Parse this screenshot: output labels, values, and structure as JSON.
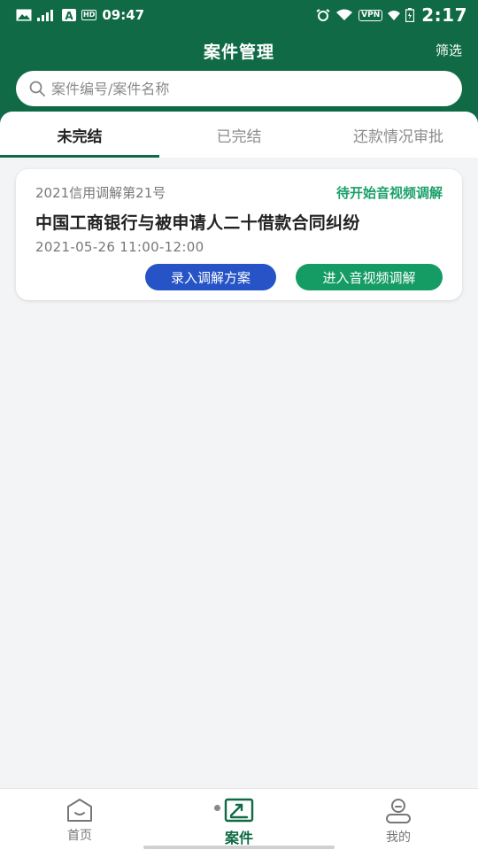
{
  "status_bar": {
    "time": "09:47",
    "clock_overlay": "2:17",
    "vpn_label": "VPN",
    "hd_label": "HD",
    "icons": [
      "image-icon",
      "signal-icon",
      "a-icon",
      "alarm-icon",
      "wifi-icon",
      "battery-icon"
    ]
  },
  "header": {
    "title": "案件管理",
    "filter_label": "筛选"
  },
  "search": {
    "placeholder": "案件编号/案件名称",
    "value": ""
  },
  "tabs": [
    {
      "label": "未完结",
      "active": true
    },
    {
      "label": "已完结",
      "active": false
    },
    {
      "label": "还款情况审批",
      "active": false
    }
  ],
  "cases": [
    {
      "number": "2021信用调解第21号",
      "status": "待开始音视频调解",
      "title": "中国工商银行与被申请人二十借款合同纠纷",
      "time": "2021-05-26 11:00-12:00",
      "actions": {
        "plan": "录入调解方案",
        "video": "进入音视频调解"
      }
    }
  ],
  "bottom_nav": [
    {
      "label": "首页",
      "icon": "home-icon",
      "active": false
    },
    {
      "label": "案件",
      "icon": "case-icon",
      "active": true
    },
    {
      "label": "我的",
      "icon": "profile-icon",
      "active": false
    }
  ],
  "colors": {
    "brand_green": "#0f6a45",
    "status_green": "#1aa06a",
    "primary_blue": "#2653c6",
    "action_green": "#159c64"
  }
}
